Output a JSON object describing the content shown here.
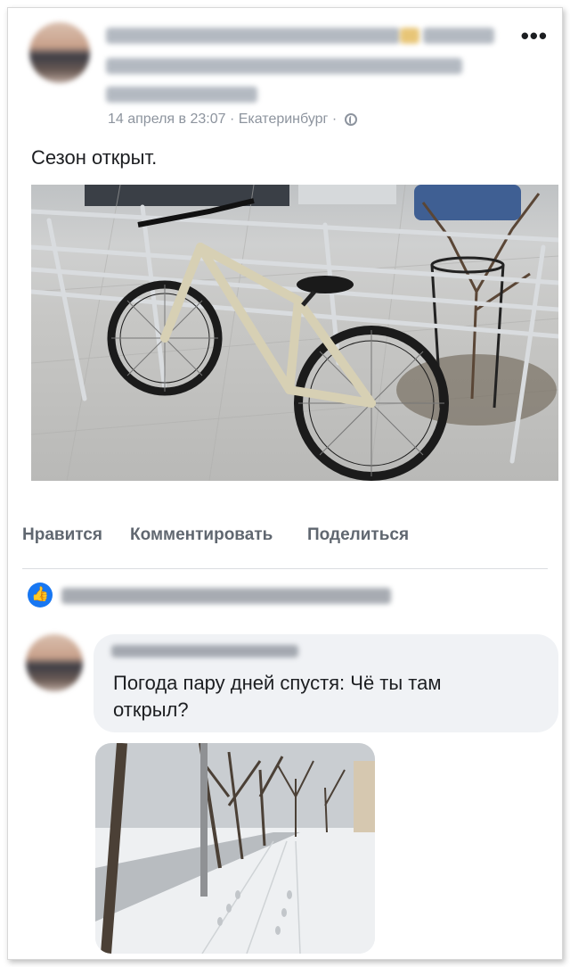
{
  "post": {
    "meta_text": "14 апреля в 23:07 · Екатеринбург ·",
    "text": "Сезон открыт.",
    "more_label": "•••"
  },
  "actions": {
    "like": "Нравится",
    "comment": "Комментировать",
    "share": "Поделиться"
  },
  "comment": {
    "text": "Погода пару дней спустя: Чё ты там открыл?"
  },
  "icons": {
    "globe": "globe-icon",
    "like": "thumbs-up-icon",
    "more": "more-dots-icon"
  },
  "colors": {
    "like_blue": "#1877f2",
    "meta_gray": "#8d949e",
    "action_gray": "#606770",
    "bubble_bg": "#f0f2f5"
  }
}
